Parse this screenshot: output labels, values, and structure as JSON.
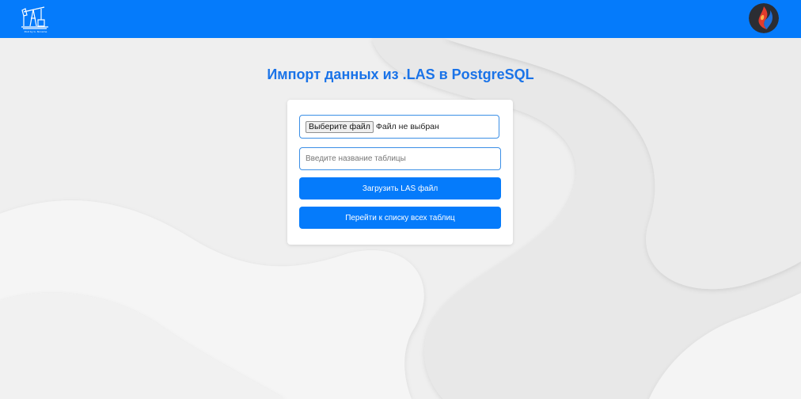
{
  "header": {
    "logo_icon": "oil-pump-icon",
    "logo_caption": "Post by G. Noname",
    "avatar_icon": "brand-logo-avatar",
    "brand_color": "#057bfb"
  },
  "main": {
    "title": "Импорт данных из .LAS в PostgreSQL"
  },
  "form": {
    "file_button_label": "Выберите файл",
    "file_status": "Файл не выбран",
    "table_name_placeholder": "Введите название таблицы",
    "upload_button_label": "Загрузить LAS файл",
    "list_button_label": "Перейти к списку всех таблиц"
  }
}
